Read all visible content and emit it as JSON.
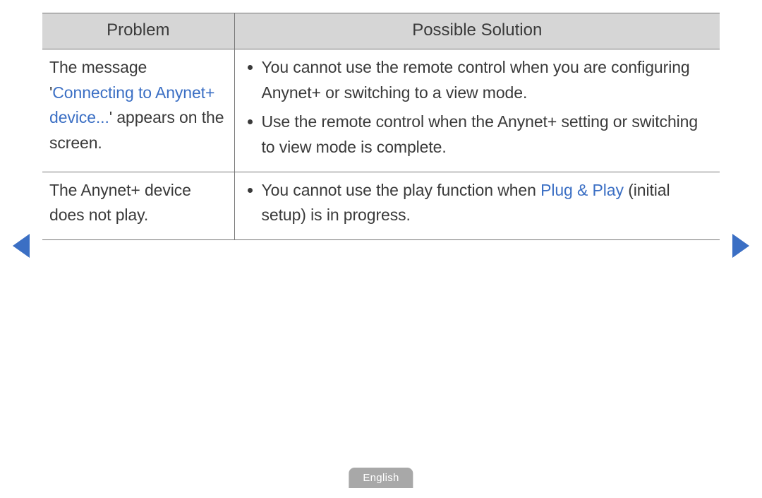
{
  "table": {
    "headers": [
      "Problem",
      "Possible Solution"
    ],
    "rows": [
      {
        "problem": {
          "pre": "The message '",
          "highlight": "Connecting to Anynet+ device...",
          "post": "' appears on the screen."
        },
        "solutions": [
          "You cannot use the remote control when you are configuring Anynet+ or switching to a view mode.",
          "Use the remote control when the Anynet+ setting or switching to view mode is complete."
        ]
      },
      {
        "problem": {
          "plain": "The Anynet+ device does not play."
        },
        "solutions_rich": [
          {
            "pre": "You cannot use the play function when ",
            "bold": "Plug & Play",
            "post": " (initial setup) is in progress."
          }
        ]
      }
    ]
  },
  "language": "English"
}
